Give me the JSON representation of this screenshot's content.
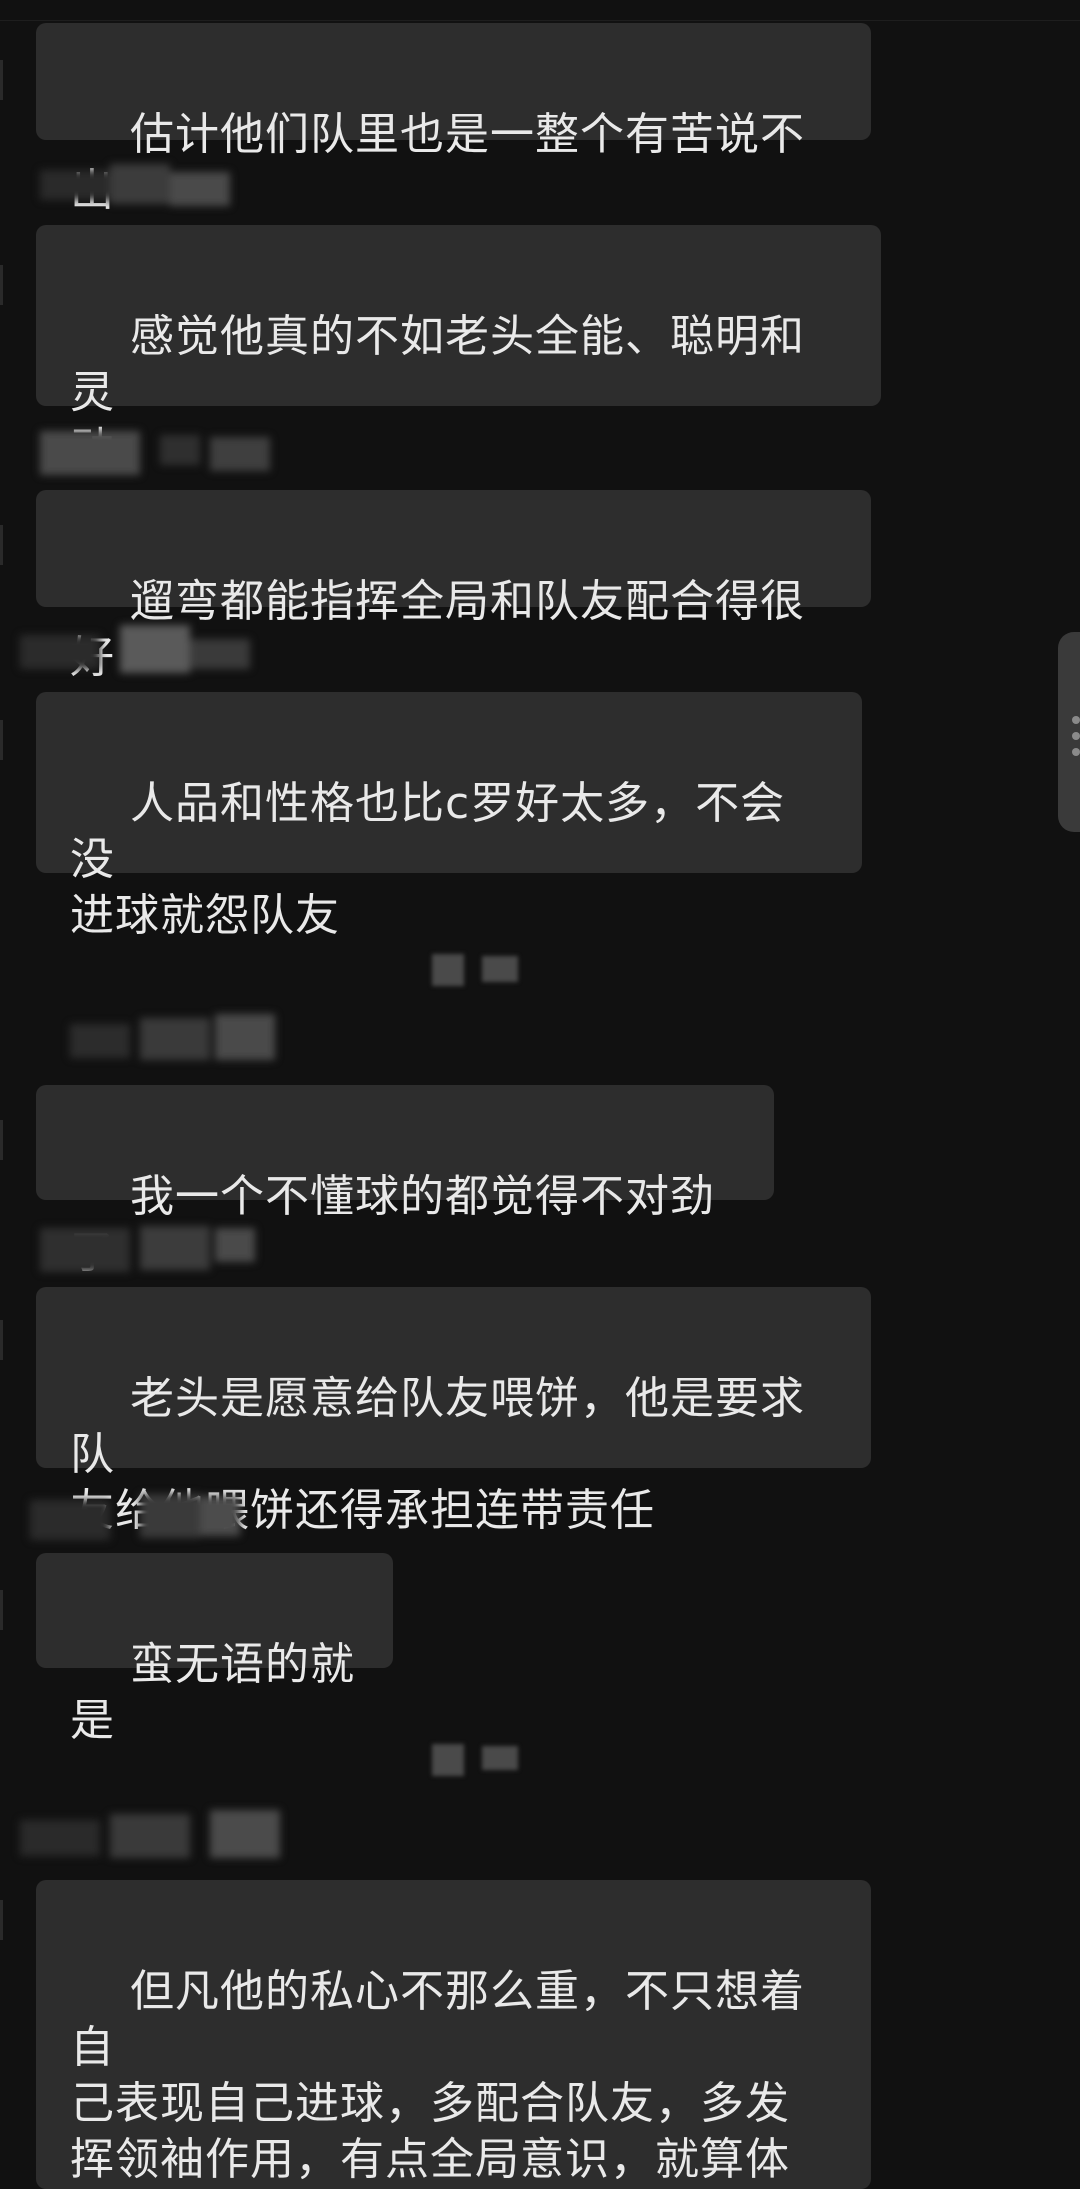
{
  "theme": {
    "background": "#111111",
    "bubble": "#2d2d2d",
    "text": "#e9e9e9"
  },
  "messages": [
    {
      "text": "估计他们队里也是一整个有苦说不出"
    },
    {
      "text": "感觉他真的不如老头全能、聪明和灵\n动"
    },
    {
      "text": "遛弯都能指挥全局和队友配合得很好"
    },
    {
      "text": "人品和性格也比c罗好太多，不会没\n进球就怨队友"
    },
    {
      "text": "我一个不懂球的都觉得不对劲了"
    },
    {
      "text": "老头是愿意给队友喂饼，他是要求队\n友给他喂饼还得承担连带责任"
    },
    {
      "text": "蛮无语的就是"
    },
    {
      "text": "但凡他的私心不那么重，不只想着自\n己表现自己进球，多配合队友，多发\n挥领袖作用，有点全局意识，就算体\n能下降了也不至于今天这么尴尬"
    }
  ],
  "icons": {
    "sender_avatar": "pixelated-avatar-icon",
    "side_handle": "more-dots-icon"
  }
}
